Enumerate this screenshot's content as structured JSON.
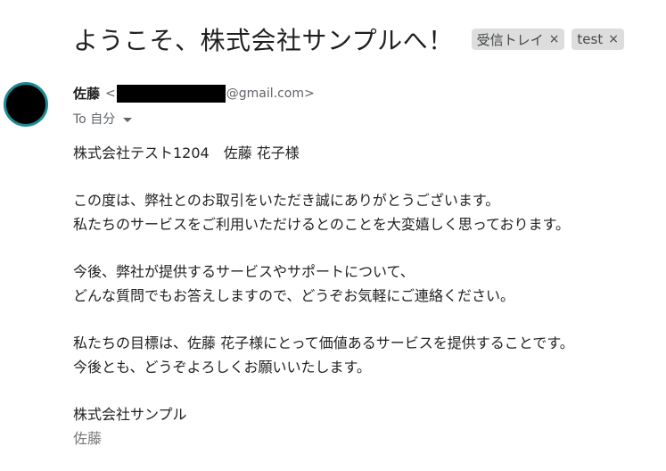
{
  "email": {
    "subject": "ようこそ、株式会社サンプルへ！",
    "labels": [
      {
        "name": "受信トレイ",
        "close": "×"
      },
      {
        "name": "test",
        "close": "×"
      }
    ],
    "sender": {
      "name": "佐藤",
      "email_prefix": "<",
      "email_suffix": "@gmail.com>"
    },
    "recipient": {
      "text": "To 自分"
    },
    "body": {
      "greeting": "株式会社テスト1204　佐藤 花子様",
      "paragraph1": [
        "この度は、弊社とのお取引をいただき誠にありがとうございます。",
        "私たちのサービスをご利用いただけるとのことを大変嬉しく思っております。"
      ],
      "paragraph2": [
        "今後、弊社が提供するサービスやサポートについて、",
        "どんな質問でもお答えしますので、どうぞお気軽にご連絡ください。"
      ],
      "paragraph3": [
        "私たちの目標は、佐藤 花子様にとって価値あるサービスを提供することです。",
        "今後とも、どうぞよろしくお願いいたします。"
      ],
      "signature_company": "株式会社サンプル",
      "signature_name": "佐藤"
    }
  },
  "colors": {
    "avatar_ring": "#1f8a94",
    "chip_bg": "#dddddd"
  }
}
